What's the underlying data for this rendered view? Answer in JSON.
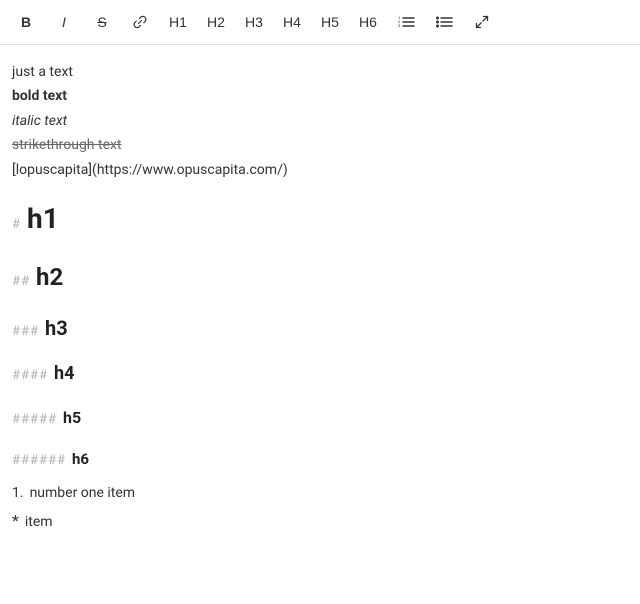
{
  "toolbar": {
    "buttons": [
      {
        "id": "bold",
        "label": "B",
        "class": "bold-btn",
        "name": "bold-button"
      },
      {
        "id": "italic",
        "label": "I",
        "class": "italic-btn",
        "name": "italic-button"
      },
      {
        "id": "strike",
        "label": "S",
        "class": "strike-btn",
        "name": "strikethrough-button"
      },
      {
        "id": "link",
        "label": "🔗",
        "class": "",
        "name": "link-button"
      },
      {
        "id": "h1",
        "label": "H1",
        "class": "",
        "name": "h1-button"
      },
      {
        "id": "h2",
        "label": "H2",
        "class": "",
        "name": "h2-button"
      },
      {
        "id": "h3",
        "label": "H3",
        "class": "",
        "name": "h3-button"
      },
      {
        "id": "h4",
        "label": "H4",
        "class": "",
        "name": "h4-button"
      },
      {
        "id": "h5",
        "label": "H5",
        "class": "",
        "name": "h5-button"
      },
      {
        "id": "h6",
        "label": "H6",
        "class": "",
        "name": "h6-button"
      },
      {
        "id": "ordered-list",
        "label": "≡",
        "class": "",
        "name": "ordered-list-button"
      },
      {
        "id": "unordered-list",
        "label": "☰",
        "class": "",
        "name": "unordered-list-button"
      },
      {
        "id": "expand",
        "label": "↗",
        "class": "",
        "name": "expand-button"
      }
    ]
  },
  "editor": {
    "lines": {
      "plain": "just a text",
      "bold": "bold text",
      "italic": "italic text",
      "strike": "strikethrough text",
      "link": "[lopuscapita](https://www.opuscapita.com/)"
    },
    "headings": [
      {
        "marks": "#",
        "text": "h1",
        "size": "h1-text",
        "name": "heading-1"
      },
      {
        "marks": "##",
        "text": "h2",
        "size": "h2-text",
        "name": "heading-2"
      },
      {
        "marks": "###",
        "text": "h3",
        "size": "h3-text",
        "name": "heading-3"
      },
      {
        "marks": "####",
        "text": "h4",
        "size": "h4-text",
        "name": "heading-4"
      },
      {
        "marks": "#####",
        "text": "h5",
        "size": "h5-text",
        "name": "heading-5"
      },
      {
        "marks": "######",
        "text": "h6",
        "size": "h6-text",
        "name": "heading-6"
      }
    ],
    "numbered_items": [
      {
        "number": "1.",
        "text": "number one item"
      }
    ],
    "bullet_items": [
      {
        "marker": "*",
        "text": "item"
      }
    ]
  }
}
